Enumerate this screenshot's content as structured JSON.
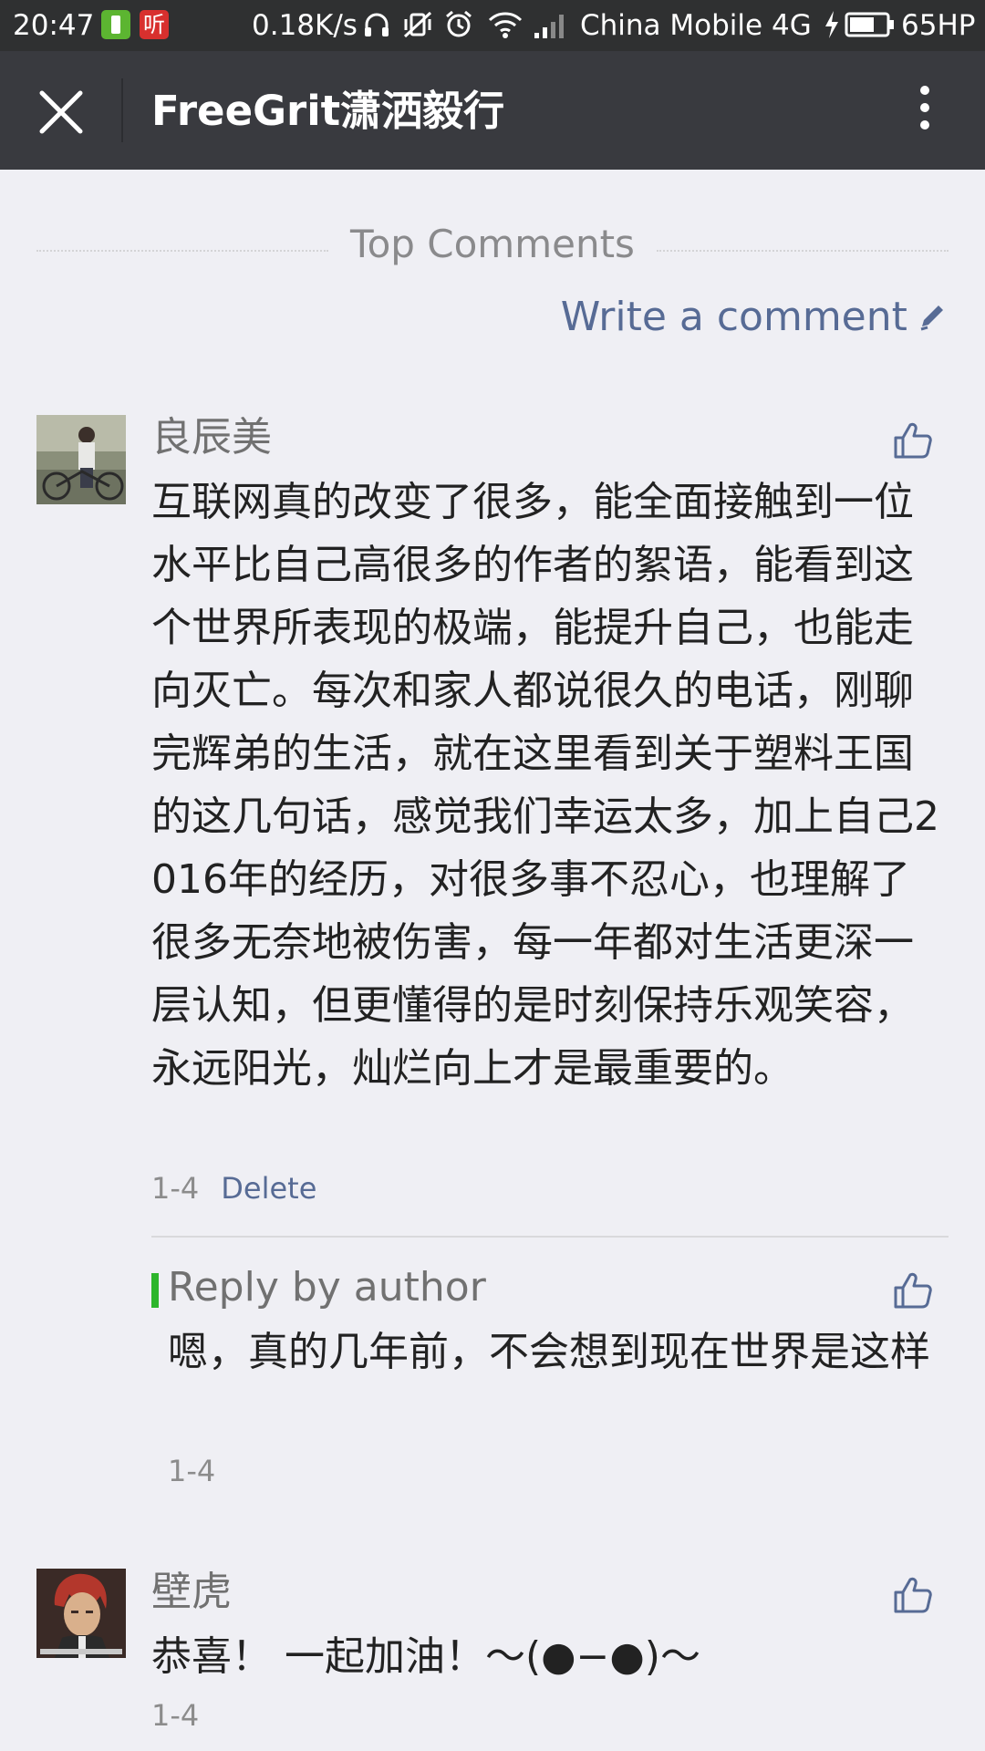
{
  "status_bar": {
    "time": "20:47",
    "app_icon_2_text": "听",
    "network_speed": "0.18K/s",
    "carrier": "China Mobile",
    "network_type": "4G",
    "battery": "65HP"
  },
  "title_bar": {
    "title": "FreeGrit潇洒毅行"
  },
  "section": {
    "heading": "Top Comments",
    "write_comment": "Write a comment"
  },
  "comments": [
    {
      "author": "良辰美",
      "text": "互联网真的改变了很多，能全面接触到一位水平比自己高很多的作者的絮语，能看到这个世界所表现的极端，能提升自己，也能走向灭亡。每次和家人都说很久的电话，刚聊完辉弟的生活，就在这里看到关于塑料王国 的这几句话，感觉我们幸运太多，加上自己2016年的经历，对很多事不忍心，也理解了很多无奈地被伤害，每一年都对生活更深一层认知，但更懂得的是时刻保持乐观笑容，永远阳光，灿烂向上才是最重要的。",
      "date": "1-4",
      "delete_label": "Delete",
      "reply": {
        "label": "Reply by author",
        "text": "嗯，真的几年前，不会想到现在世界是这样",
        "date": "1-4"
      }
    },
    {
      "author": "壁虎",
      "text": "恭喜！ 一起加油！～(●−●)～",
      "date": "1-4"
    }
  ],
  "colors": {
    "link": "#576b95",
    "reply_bar": "#2db52b",
    "title_bar": "#393a3f"
  }
}
